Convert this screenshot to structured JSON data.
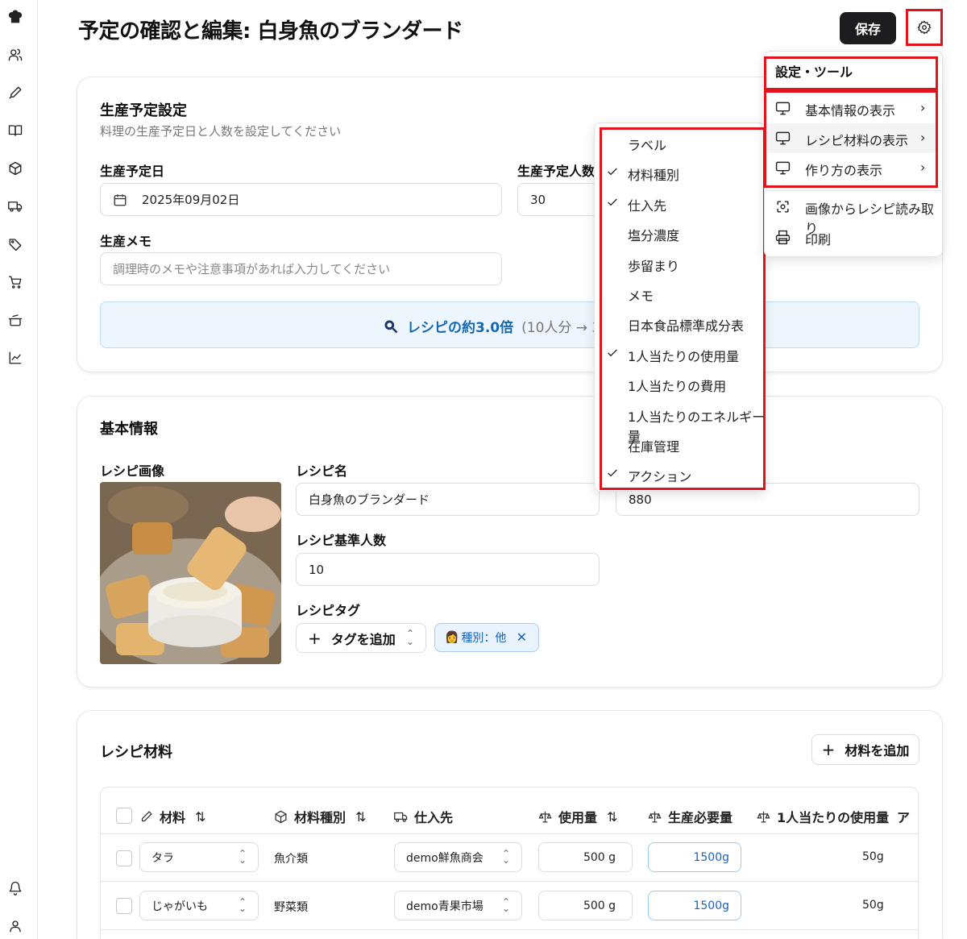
{
  "header": {
    "title": "予定の確認と編集: 白身魚のブランダード",
    "save_label": "保存"
  },
  "sidebar": {
    "icons": [
      "chef-hat-icon",
      "users-icon",
      "pen-icon",
      "book-icon",
      "box-icon",
      "truck-icon",
      "tags-icon",
      "cart-icon",
      "pot-icon",
      "chart-icon",
      "bell-icon",
      "user-icon"
    ]
  },
  "production": {
    "title": "生産予定設定",
    "description": "料理の生産予定日と人数を設定してください",
    "date_label": "生産予定日",
    "date_value": "2025年09月02日",
    "people_label": "生産予定人数",
    "people_value": "30",
    "memo_label": "生産メモ",
    "memo_placeholder": "調理時のメモや注意事項があれば入力してください",
    "ratio_main": "レシピの約3.0倍",
    "ratio_sub": "(10人分 → 3"
  },
  "basic": {
    "title": "基本情報",
    "image_label": "レシピ画像",
    "name_label": "レシピ名",
    "name_value": "白身魚のブランダード",
    "price_value": "880",
    "servings_label": "レシピ基準人数",
    "servings_value": "10",
    "tag_label": "レシピタグ",
    "add_tag": "タグを追加",
    "tag_chip": "種別：他"
  },
  "materials": {
    "title": "レシピ材料",
    "add_label": "材料を追加",
    "columns": [
      "材料",
      "材料種別",
      "仕入先",
      "使用量",
      "生産必要量",
      "1人当たりの使用量",
      "ア"
    ],
    "rows": [
      {
        "name": "タラ",
        "type": "魚介類",
        "supplier": "demo鮮魚商会",
        "amount": "500 g",
        "required": "1500g",
        "per_person": "50g"
      },
      {
        "name": "じゃがいも",
        "type": "野菜類",
        "supplier": "demo青果市場",
        "amount": "500 g",
        "required": "1500g",
        "per_person": "50g"
      }
    ]
  },
  "column_menu": {
    "items": [
      {
        "label": "ラベル",
        "checked": false
      },
      {
        "label": "材料種別",
        "checked": true
      },
      {
        "label": "仕入先",
        "checked": true
      },
      {
        "label": "塩分濃度",
        "checked": false
      },
      {
        "label": "歩留まり",
        "checked": false
      },
      {
        "label": "メモ",
        "checked": false
      },
      {
        "label": "日本食品標準成分表",
        "checked": false
      },
      {
        "label": "1人当たりの使用量",
        "checked": true
      },
      {
        "label": "1人当たりの費用",
        "checked": false
      },
      {
        "label": "1人当たりのエネルギー量",
        "checked": false
      },
      {
        "label": "在庫管理",
        "checked": false
      },
      {
        "label": "アクション",
        "checked": true
      }
    ]
  },
  "settings_menu": {
    "title": "設定・ツール",
    "items": [
      {
        "label": "基本情報の表示",
        "icon": "monitor-icon"
      },
      {
        "label": "レシピ材料の表示",
        "icon": "monitor-icon"
      },
      {
        "label": "作り方の表示",
        "icon": "monitor-icon"
      },
      {
        "label": "画像からレシピ読み取り",
        "icon": "scan-icon"
      },
      {
        "label": "印刷",
        "icon": "printer-icon"
      }
    ]
  }
}
